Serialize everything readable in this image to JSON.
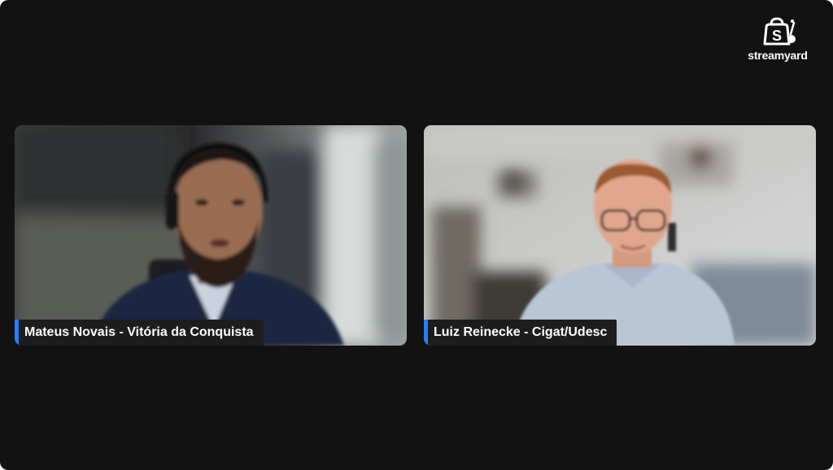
{
  "branding": {
    "name": "streamyard",
    "icon": "streamyard-logo-icon"
  },
  "participants": [
    {
      "name": "Mateus Novais - Vitória da Conquista",
      "video": "participant-video"
    },
    {
      "name": "Luiz Reinecke - Cigat/Udesc",
      "video": "participant-video"
    }
  ],
  "colors": {
    "background": "#121212",
    "name_tag_accent": "#2b7cff",
    "name_tag_bg": "#1d1d1d"
  }
}
